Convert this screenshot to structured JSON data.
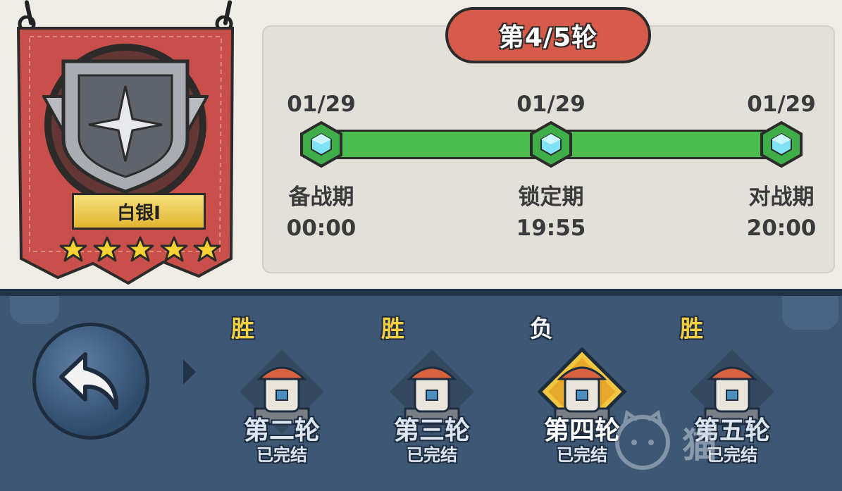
{
  "rank": {
    "tier": "白银I",
    "stars": 5
  },
  "round_header": "第4/5轮",
  "timeline": [
    {
      "date": "01/29",
      "phase": "备战期",
      "time": "00:00"
    },
    {
      "date": "01/29",
      "phase": "锁定期",
      "time": "19:55"
    },
    {
      "date": "01/29",
      "phase": "对战期",
      "time": "20:00"
    }
  ],
  "rounds": [
    {
      "result": "胜",
      "label": "第二轮",
      "status": "已完结",
      "selected": false
    },
    {
      "result": "胜",
      "label": "第三轮",
      "status": "已完结",
      "selected": false
    },
    {
      "result": "负",
      "label": "第四轮",
      "status": "已完结",
      "selected": true
    },
    {
      "result": "胜",
      "label": "第五轮",
      "status": "已完结",
      "selected": false
    }
  ],
  "watermark": "猫",
  "colors": {
    "banner": "#c9504a",
    "timeline_green": "#4bbd4e",
    "pill": "#d75b4a",
    "bottom": "#3e5775",
    "win": "#f5cf40"
  },
  "icons": [
    "shield-emblem-icon",
    "star-icon",
    "gem-node-icon",
    "back-arrow-icon",
    "tower-icon"
  ]
}
